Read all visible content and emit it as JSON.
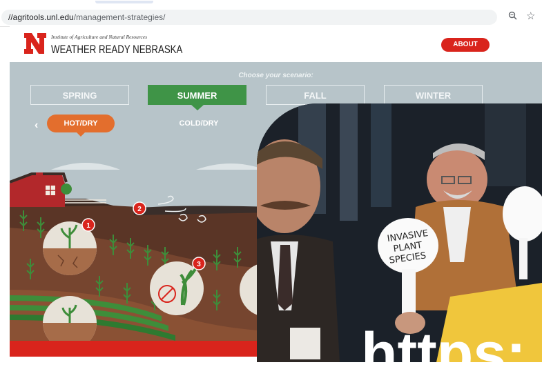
{
  "browser": {
    "url_host": "//agritools.unl.edu",
    "url_path": "/management-strategies/",
    "zoom_icon": "zoom-icon",
    "bookmark_icon": "star-icon"
  },
  "header": {
    "institute": "Institute of Agriculture and Natural Resources",
    "title": "WEATHER READY NEBRASKA",
    "about_label": "ABOUT",
    "brand_color": "#d9241c"
  },
  "scenario": {
    "prompt": "Choose your scenario:",
    "seasons": [
      {
        "label": "SPRING",
        "active": false
      },
      {
        "label": "SUMMER",
        "active": true
      },
      {
        "label": "FALL",
        "active": false
      },
      {
        "label": "WINTER",
        "active": false
      }
    ],
    "conditions": [
      {
        "label": "HOT/DRY",
        "active": true
      },
      {
        "label": "COLD/DRY",
        "active": false
      }
    ],
    "markers": [
      "1",
      "2",
      "3"
    ],
    "active_color": "#3f9447",
    "condition_color": "#e36e2d"
  },
  "photo": {
    "sign_text": [
      "INVASIVE",
      "PLANT",
      "SPECIES"
    ],
    "overlay_text": "https:"
  }
}
